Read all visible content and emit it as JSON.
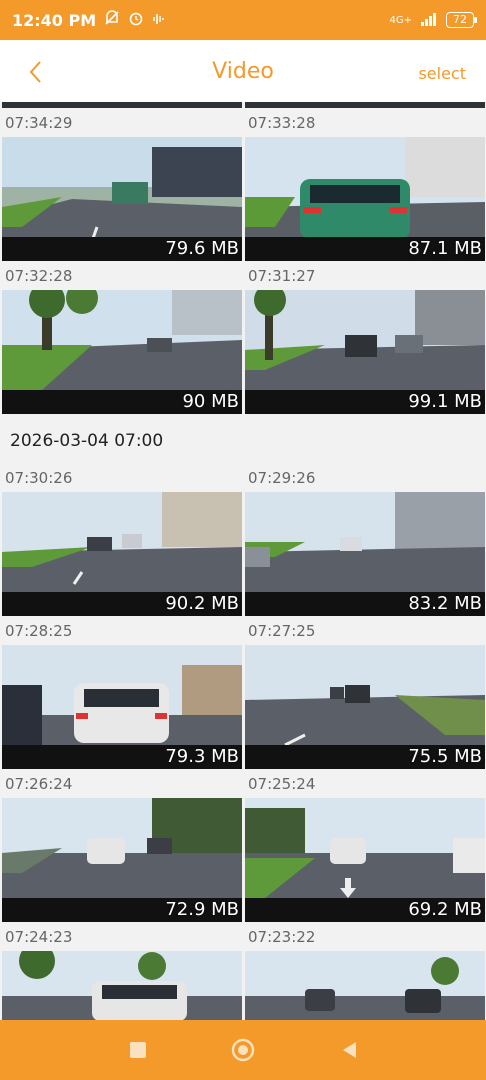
{
  "status": {
    "time": "12:40 PM",
    "network": "4G+",
    "battery": "72"
  },
  "header": {
    "title": "Video",
    "select_label": "select"
  },
  "groups": [
    {
      "label": "",
      "items": [
        {
          "time": "07:34:29",
          "size": "79.6 MB",
          "scene": "road-left"
        },
        {
          "time": "07:33:28",
          "size": "87.1 MB",
          "scene": "car-rear"
        },
        {
          "time": "07:32:28",
          "size": "90 MB",
          "scene": "road-trees"
        },
        {
          "time": "07:31:27",
          "size": "99.1 MB",
          "scene": "road-right"
        }
      ]
    },
    {
      "label": "2026-03-04 07:00",
      "items": [
        {
          "time": "07:30:26",
          "size": "90.2 MB",
          "scene": "road-buildings"
        },
        {
          "time": "07:29:26",
          "size": "83.2 MB",
          "scene": "road-bridge"
        },
        {
          "time": "07:28:25",
          "size": "79.3 MB",
          "scene": "car-rear-white"
        },
        {
          "time": "07:27:25",
          "size": "75.5 MB",
          "scene": "road-open"
        },
        {
          "time": "07:26:24",
          "size": "72.9 MB",
          "scene": "road-left"
        },
        {
          "time": "07:25:24",
          "size": "69.2 MB",
          "scene": "road-arrow"
        },
        {
          "time": "07:24:23",
          "size": "",
          "scene": "car-rear-white"
        },
        {
          "time": "07:23:22",
          "size": "",
          "scene": "road-open"
        }
      ]
    }
  ]
}
